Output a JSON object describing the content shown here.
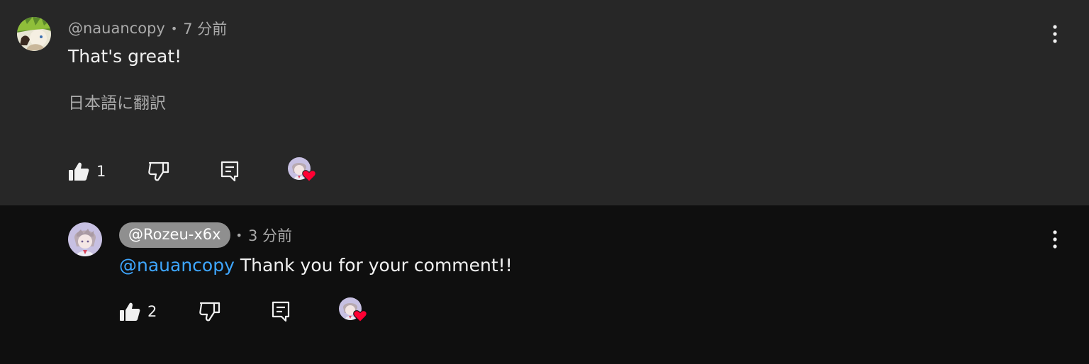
{
  "comment": {
    "author": "@nauancopy",
    "separator": "•",
    "time": "7 分前",
    "text": "That's great!",
    "translate_label": "日本語に翻訳",
    "like_count": "1",
    "heart_by_creator": true
  },
  "reply": {
    "author": "@Rozeu-x6x",
    "separator": "•",
    "time": "3 分前",
    "mention": "@nauancopy",
    "text": " Thank you for your comment!!",
    "like_count": "2",
    "heart_by_creator": true
  },
  "icons": {
    "like": "thumbs-up-icon",
    "dislike": "thumbs-down-icon",
    "reply": "reply-icon",
    "more": "more-vertical-icon",
    "heart": "heart-icon"
  },
  "colors": {
    "highlight_bg": "#272727",
    "page_bg": "#0f0f0f",
    "mention": "#3ea6ff",
    "heart": "#ff0033",
    "author_chip": "#8f8f8f"
  }
}
